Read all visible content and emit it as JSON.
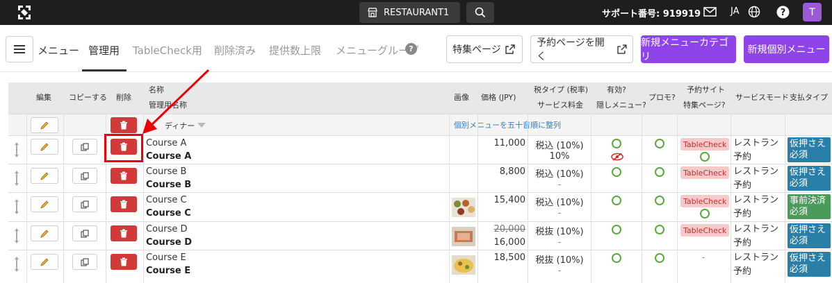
{
  "topbar": {
    "restaurant": "RESTAURANT1",
    "support": "サポート番号: 919919",
    "lang": "JA",
    "avatar": "T"
  },
  "nav": {
    "title": "メニュー",
    "tabs": [
      "管理用",
      "TableCheck用",
      "削除済み",
      "提供数上限",
      "メニューグループ"
    ],
    "btn_feature": "特集ページ",
    "btn_booking": "予約ページを開く",
    "btn_new_category": "新規メニューカテゴリ",
    "btn_new_item": "新規個別メニュー"
  },
  "headers": {
    "edit": "編集",
    "copy": "コピーする",
    "delete": "削除",
    "name1": "名称",
    "name2": "管理用名称",
    "image": "画像",
    "price": "価格 (JPY)",
    "tax1": "税タイプ (税率)",
    "tax2": "サービス料金",
    "valid1": "有効?",
    "valid2": "隠しメニュー?",
    "promo": "プロモ?",
    "site1": "予約サイト",
    "site2": "特集ページ?",
    "mode": "サービスモード",
    "pay": "支払タイプ"
  },
  "category": {
    "name": "ディナー",
    "sort_link": "個別メニューを五十音順に整列"
  },
  "rows": [
    {
      "name": "Course A",
      "admin": "Course A",
      "price": "11,000",
      "tax": "税込 (10%)",
      "service": "10%",
      "site": "TableCheck",
      "mode": "レストラン予約",
      "pay": "仮押さえ必須"
    },
    {
      "name": "Course B",
      "admin": "Course B",
      "price": "8,800",
      "tax": "税込 (10%)",
      "service": "-",
      "site": "TableCheck",
      "mode": "レストラン予約",
      "pay": "仮押さえ必須"
    },
    {
      "name": "Course C",
      "admin": "Course C",
      "price": "15,400",
      "tax": "税込 (10%)",
      "service": "-",
      "site": "TableCheck",
      "mode": "レストラン予約",
      "pay": "事前決済必須"
    },
    {
      "name": "Course D",
      "admin": "Course D",
      "price_old": "20,000",
      "price": "16,000",
      "tax": "税抜 (10%)",
      "service": "-",
      "site": "TableCheck",
      "mode": "レストラン予約",
      "pay": "仮押さえ必須"
    },
    {
      "name": "Course E",
      "admin": "Course E",
      "price": "18,500",
      "tax": "税抜 (10%)",
      "service": "-",
      "site": "-",
      "mode": "レストラン予約",
      "pay": "仮押さえ必須"
    }
  ],
  "colors": {
    "purple": "#8e44e8",
    "delete_red": "#d23a3a",
    "annotation_red": "#e00000"
  }
}
